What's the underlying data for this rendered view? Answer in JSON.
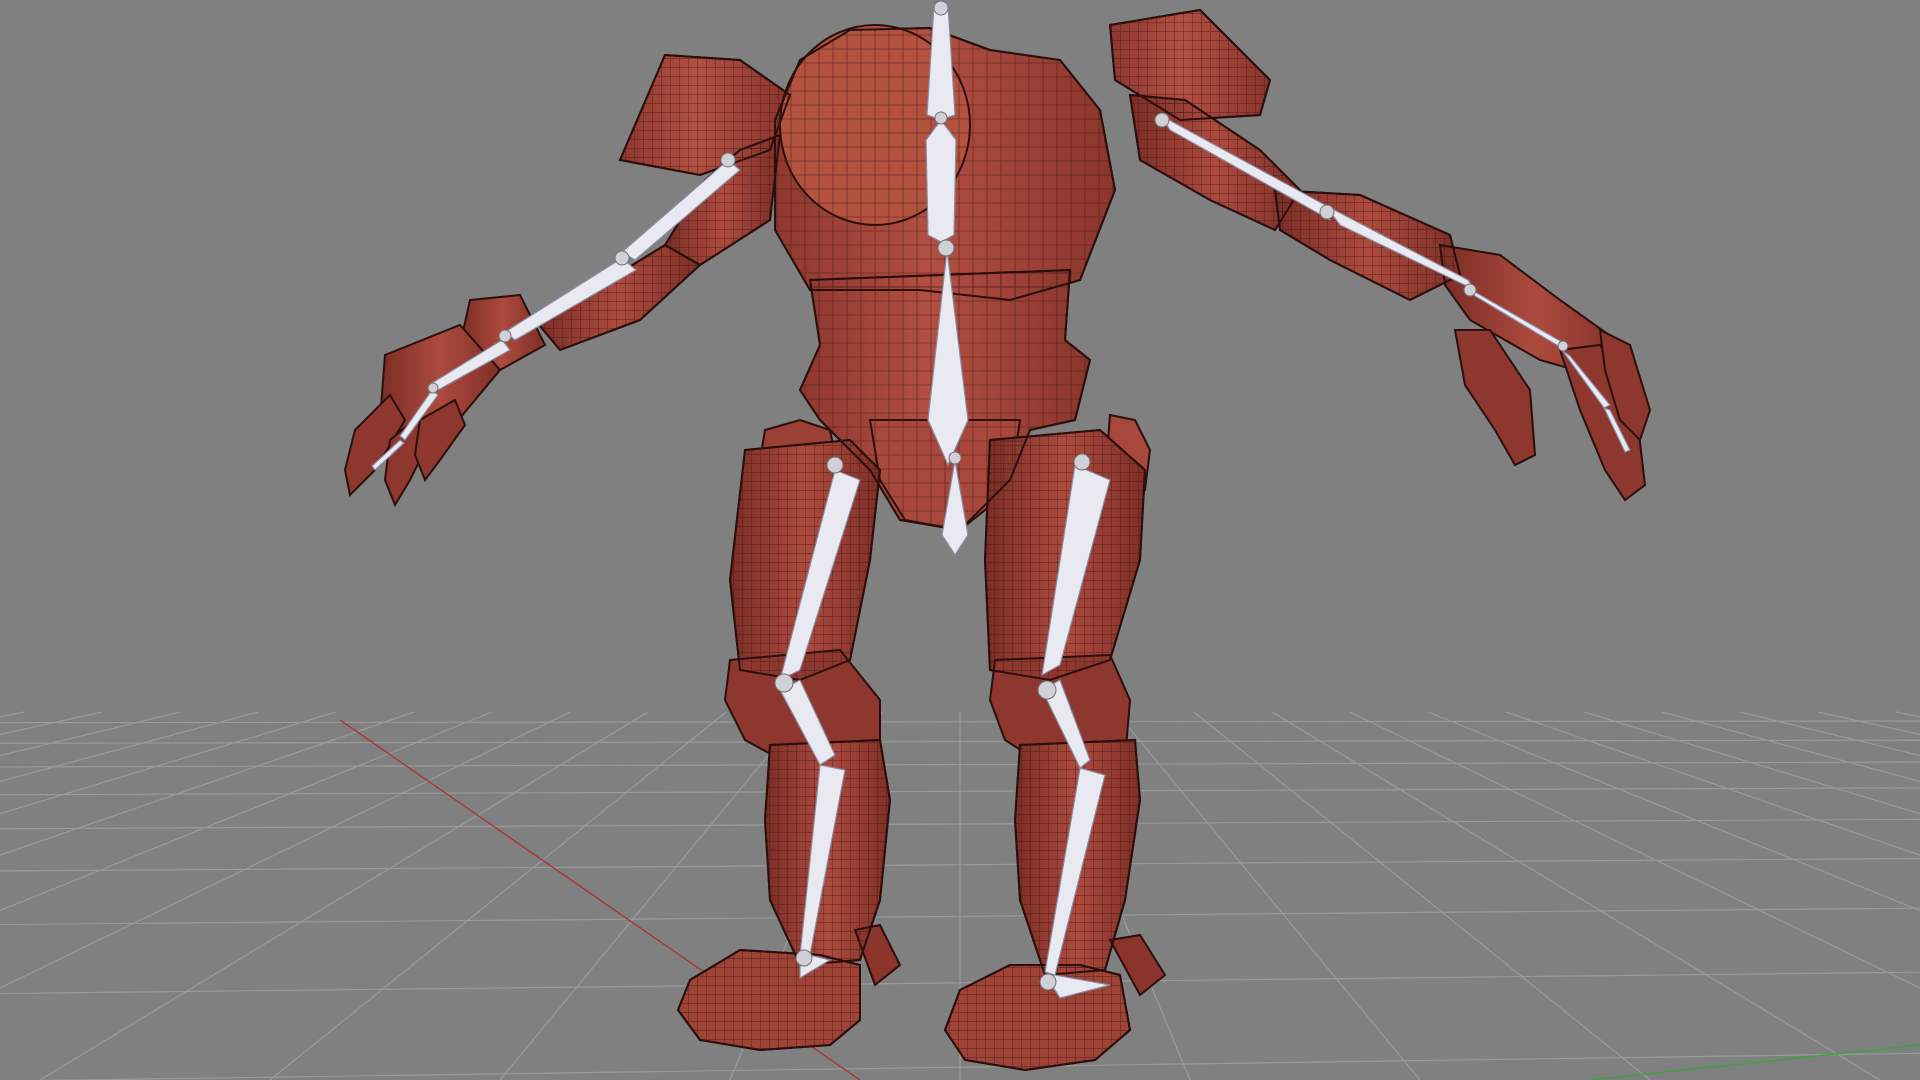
{
  "viewport": {
    "background": "#808080",
    "grid_color": "#9a9a9a",
    "axis_x_color": "#b03030",
    "axis_y_color": "#30a030"
  },
  "model": {
    "material_color": "#a8473b",
    "material_dark": "#7d2f27",
    "wire_color": "#3a1612"
  },
  "armature": {
    "bone_color": "#ececf4",
    "bone_shadow": "#b9b9cc"
  }
}
